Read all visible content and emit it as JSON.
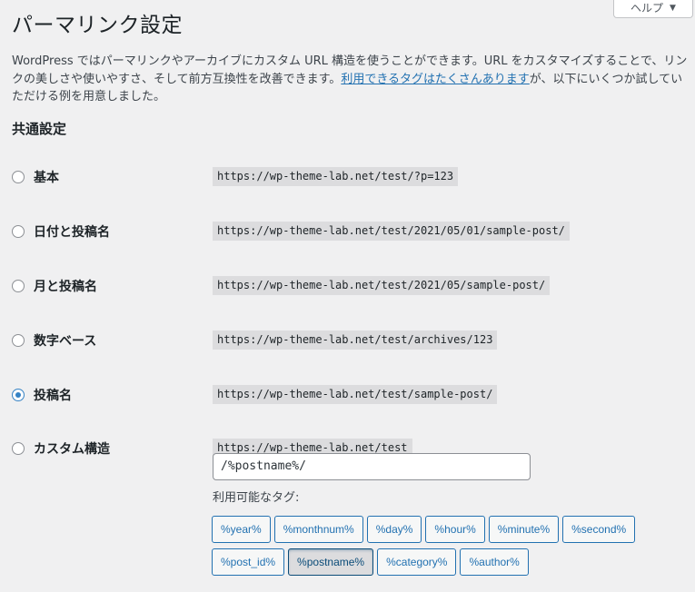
{
  "help": {
    "label": "ヘルプ",
    "caret": "▼"
  },
  "page": {
    "title": "パーマリンク設定",
    "intro_before": "WordPress ではパーマリンクやアーカイブにカスタム URL 構造を使うことができます。URL をカスタマイズすることで、リンクの美しさや使いやすさ、そして前方互換性を改善できます。",
    "intro_link": "利用できるタグはたくさんあります",
    "intro_after": "が、以下にいくつか試していただける例を用意しました。"
  },
  "common_settings": {
    "title": "共通設定",
    "options": [
      {
        "label": "基本",
        "example": "https://wp-theme-lab.net/test/?p=123",
        "checked": false
      },
      {
        "label": "日付と投稿名",
        "example": "https://wp-theme-lab.net/test/2021/05/01/sample-post/",
        "checked": false
      },
      {
        "label": "月と投稿名",
        "example": "https://wp-theme-lab.net/test/2021/05/sample-post/",
        "checked": false
      },
      {
        "label": "数字ベース",
        "example": "https://wp-theme-lab.net/test/archives/123",
        "checked": false
      },
      {
        "label": "投稿名",
        "example": "https://wp-theme-lab.net/test/sample-post/",
        "checked": true
      },
      {
        "label": "カスタム構造",
        "example": "https://wp-theme-lab.net/test",
        "checked": false
      }
    ]
  },
  "custom": {
    "value": "/%postname%/",
    "available_tags_label": "利用可能なタグ:",
    "tags": [
      "%year%",
      "%monthnum%",
      "%day%",
      "%hour%",
      "%minute%",
      "%second%",
      "%post_id%",
      "%postname%",
      "%category%",
      "%author%"
    ],
    "active_tag": "%postname%"
  }
}
